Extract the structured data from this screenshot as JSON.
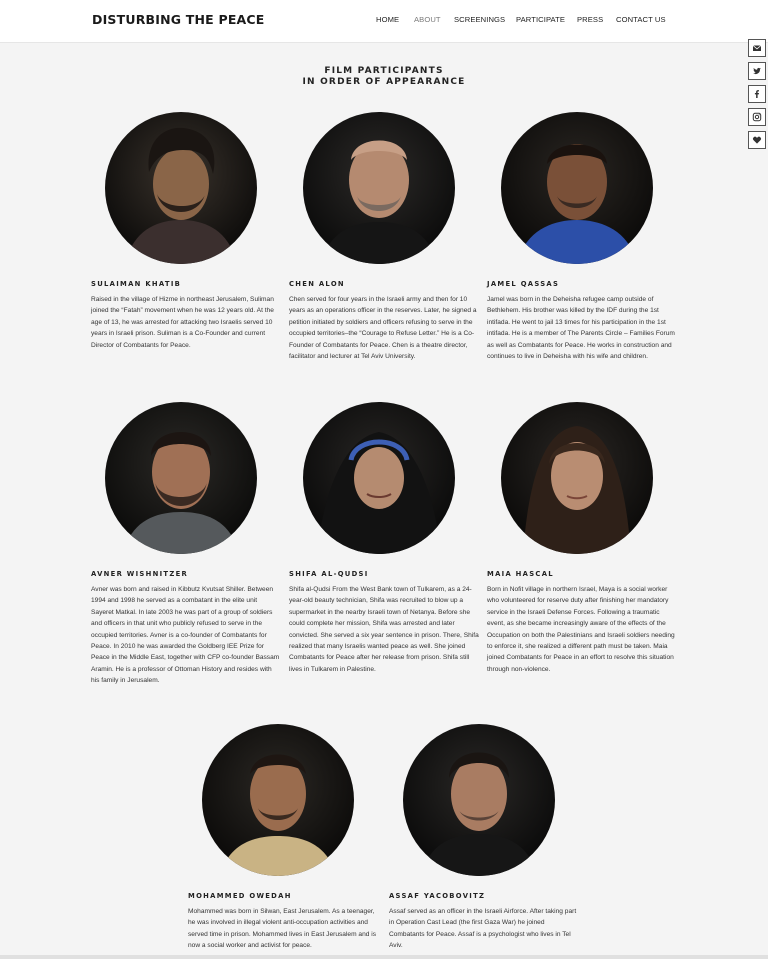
{
  "brand": "DISTURBING THE PEACE",
  "nav": [
    {
      "label": "HOME",
      "active": false
    },
    {
      "label": "ABOUT",
      "active": true
    },
    {
      "label": "SCREENINGS",
      "active": false
    },
    {
      "label": "PARTICIPATE",
      "active": false
    },
    {
      "label": "PRESS",
      "active": false
    },
    {
      "label": "CONTACT US",
      "active": false
    }
  ],
  "social_icons": [
    "email-icon",
    "twitter-icon",
    "facebook-icon",
    "instagram-icon",
    "heart-icon"
  ],
  "section_title": {
    "line1": "FILM PARTICIPANTS",
    "line2": "IN ORDER OF APPEARANCE"
  },
  "participants": [
    {
      "name": "SULAIMAN KHATIB",
      "bio": "Raised in the village of Hizme in northeast Jerusalem, Suliman joined the “Fatah” movement when he was 12 years old. At the age of 13, he was arrested for attacking two Israelis served 10 years in Israeli prison. Suliman is a Co-Founder and current Director of Combatants for Peace."
    },
    {
      "name": "CHEN ALON",
      "bio": "Chen served for four years in the Israeli army and then for 10 years as an operations officer in the reserves. Later, he signed a petition initiated by soldiers and officers refusing to serve in the occupied territories–the “Courage to Refuse Letter.” He is a Co-Founder of Combatants for Peace. Chen is a theatre director, facilitator and lecturer at Tel Aviv University."
    },
    {
      "name": "JAMEL QASSAS",
      "bio": "Jamel was born in the Deheisha refugee camp outside of Bethlehem. His brother was killed by the IDF during the 1st intifada. He went to jail 13 times for his participation in the 1st intifada. He is a member of The Parents Circle – Families Forum as well as Combatants for Peace. He works in construction and continues to live in Deheisha with his wife and children."
    },
    {
      "name": "AVNER WISHNITZER",
      "bio": "Avner was born and raised in Kibbutz Kvutsat Shiller. Between 1994 and 1998 he served as a combatant in the elite unit Sayeret Matkal. In late 2003 he was part of a group of soldiers and officers in that unit who publicly refused to serve in the occupied territories. Avner is a co-founder of Combatants for Peace. In 2010 he was awarded the Goldberg IEE Prize for Peace in the Middle East, together with CFP co-founder Bassam Aramin. He is a professor of Ottoman History and resides with his family in Jerusalem."
    },
    {
      "name": "SHIFA AL-QUDSI",
      "bio": "Shifa al-Qudsi From the West Bank town of Tulkarem, as a 24-year-old beauty technician, Shifa was recruited to blow up a supermarket in the nearby Israeli town of Netanya. Before she could complete her mission, Shifa was arrested and later convicted. She served a six year sentence in prison. There, Shifa realized that many Israelis wanted peace as well. She joined Combatants for Peace after her release from prison. Shifa still lives in Tulkarem in Palestine."
    },
    {
      "name": "MAIA HASCAL",
      "bio": "Born in Nofit village in northern Israel, Maya is a social worker who volunteered for reserve duty after finishing her mandatory service in the Israeli Defense Forces. Following a traumatic event, as she became increasingly aware of the effects of the Occupation on both the Palestinians and Israeli soldiers needing to enforce it, she realized a different path must be taken. Maia joined Combatants for Peace in an effort to resolve this situation through non-violence."
    },
    {
      "name": "MOHAMMED OWEDAH",
      "bio": "Mohammed was born in Silwan, East Jerusalem. As a teenager, he was involved in illegal violent anti-occupation activities and served time in prison. Mohammed lives in East Jerusalem and is now a social worker and activist for peace."
    },
    {
      "name": "ASSAF YACOBOVITZ",
      "bio": "Assaf served as an officer in the Israeli Airforce. After taking part in Operation Cast Lead (the first Gaza War) he joined Combatants for Peace. Assaf is a psychologist who lives in Tel Aviv."
    }
  ]
}
